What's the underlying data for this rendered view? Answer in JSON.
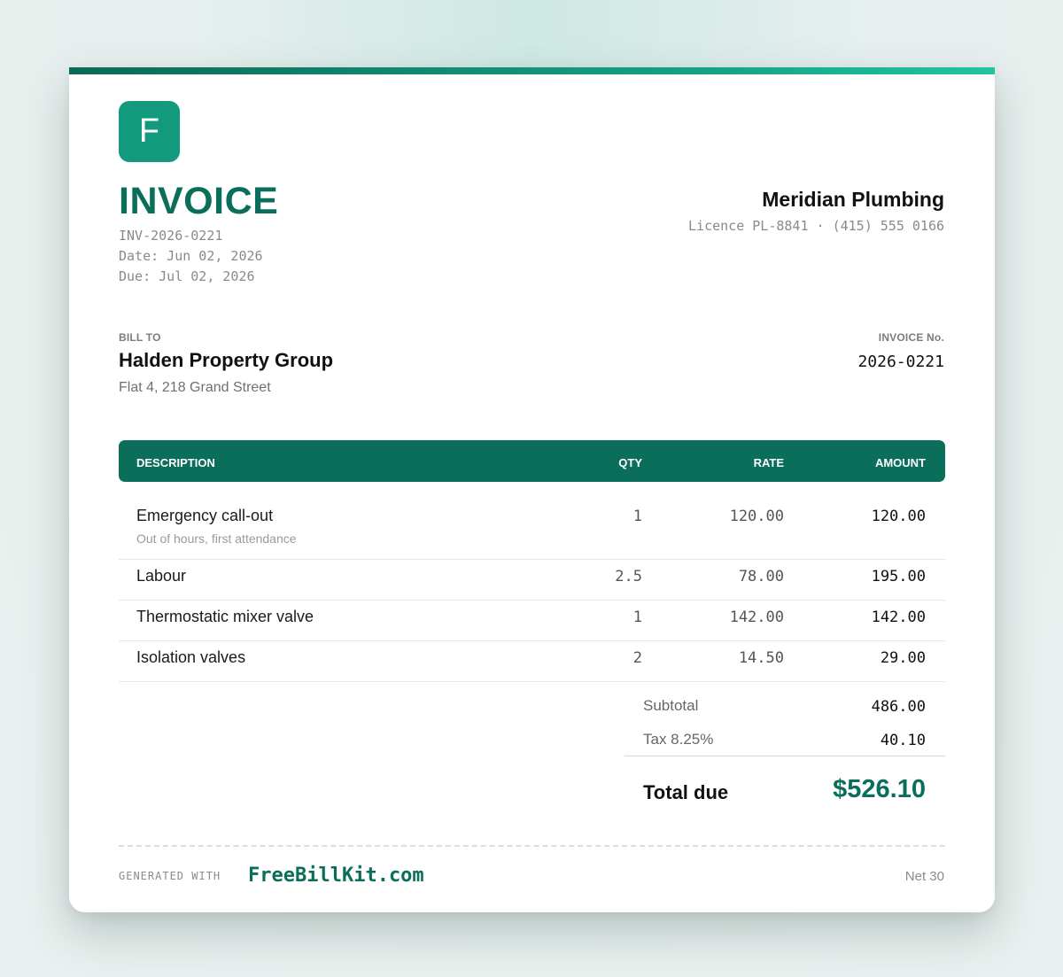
{
  "colors": {
    "accent": "#0b6e5a",
    "logo_bg": "#139a7c",
    "table_header_bg": "#0b6e5a"
  },
  "logo": {
    "letter": "F"
  },
  "invoice": {
    "title": "INVOICE",
    "id_line": "INV-2026-0221",
    "date_line": "Date: Jun 02, 2026",
    "due_line": "Due: Jul 02, 2026"
  },
  "company": {
    "name": "Meridian Plumbing",
    "details": "Licence PL-8841 · (415) 555 0166"
  },
  "bill_to": {
    "label": "BILL TO",
    "name": "Halden Property Group",
    "address": "Flat 4, 218 Grand Street"
  },
  "invoice_no": {
    "label": "INVOICE No.",
    "value": "2026-0221"
  },
  "table": {
    "headers": {
      "description": "DESCRIPTION",
      "qty": "QTY",
      "rate": "RATE",
      "amount": "AMOUNT"
    },
    "rows": [
      {
        "description": "Emergency call-out",
        "note": "Out of hours, first attendance",
        "qty": "1",
        "rate": "120.00",
        "amount": "120.00"
      },
      {
        "description": "Labour",
        "qty": "2.5",
        "rate": "78.00",
        "amount": "195.00"
      },
      {
        "description": "Thermostatic mixer valve",
        "qty": "1",
        "rate": "142.00",
        "amount": "142.00"
      },
      {
        "description": "Isolation valves",
        "qty": "2",
        "rate": "14.50",
        "amount": "29.00"
      }
    ]
  },
  "totals": {
    "subtotal_label": "Subtotal",
    "subtotal_value": "486.00",
    "tax_label": "Tax 8.25%",
    "tax_value": "40.10",
    "total_label": "Total due",
    "total_value": "$526.10"
  },
  "footer": {
    "generated_with": "GENERATED WITH",
    "brand": "FreeBillKit.com",
    "terms": "Net 30"
  }
}
